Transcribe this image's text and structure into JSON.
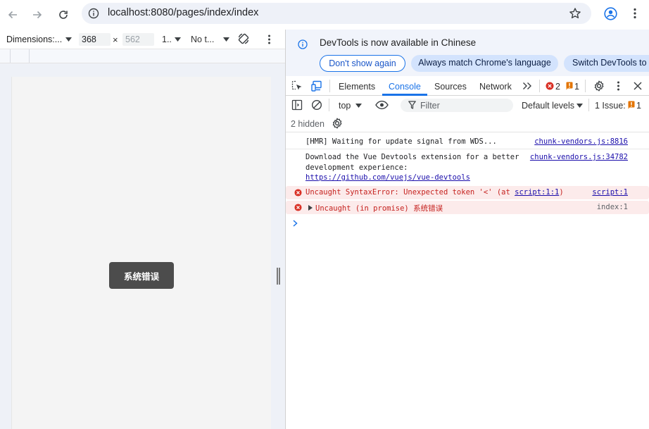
{
  "browser": {
    "url": "localhost:8080/pages/index/index"
  },
  "device_toolbar": {
    "dimensions_label": "Dimensions:...",
    "width_value": "368",
    "times": "×",
    "height_placeholder": "562",
    "zoom_label": "1..",
    "throttle_label": "No t..."
  },
  "device_page": {
    "toast_text": "系统错误"
  },
  "infobar": {
    "message": "DevTools is now available in Chinese",
    "btn_dont_show": "Don't show again",
    "btn_always_match": "Always match Chrome's language",
    "btn_switch": "Switch DevTools to Chinese"
  },
  "devtools_tabs": {
    "elements": "Elements",
    "console": "Console",
    "sources": "Sources",
    "network": "Network",
    "error_count": "2",
    "warning_count": "1"
  },
  "console_toolbar": {
    "context": "top",
    "filter_placeholder": "Filter",
    "levels": "Default levels",
    "issues": "1 Issue:",
    "issues_count": "1",
    "hidden": "2 hidden"
  },
  "console_logs": [
    {
      "text": "[HMR] Waiting for update signal from WDS...",
      "source": "chunk-vendors.js:8816"
    },
    {
      "text": "Download the Vue Devtools extension for a better",
      "text2": "development experience:",
      "link": "https://github.com/vuejs/vue-devtools",
      "source": "chunk-vendors.js:34782"
    },
    {
      "text": "Uncaught SyntaxError: Unexpected token '<' (at ",
      "link": "script:1:1",
      "text_end": ")",
      "source": "script:1"
    },
    {
      "text": "Uncaught (in promise) 系统错误",
      "source": "index:1"
    }
  ],
  "colors": {
    "accent": "#1a73e8",
    "error": "#d93025",
    "warning": "#e37400"
  }
}
